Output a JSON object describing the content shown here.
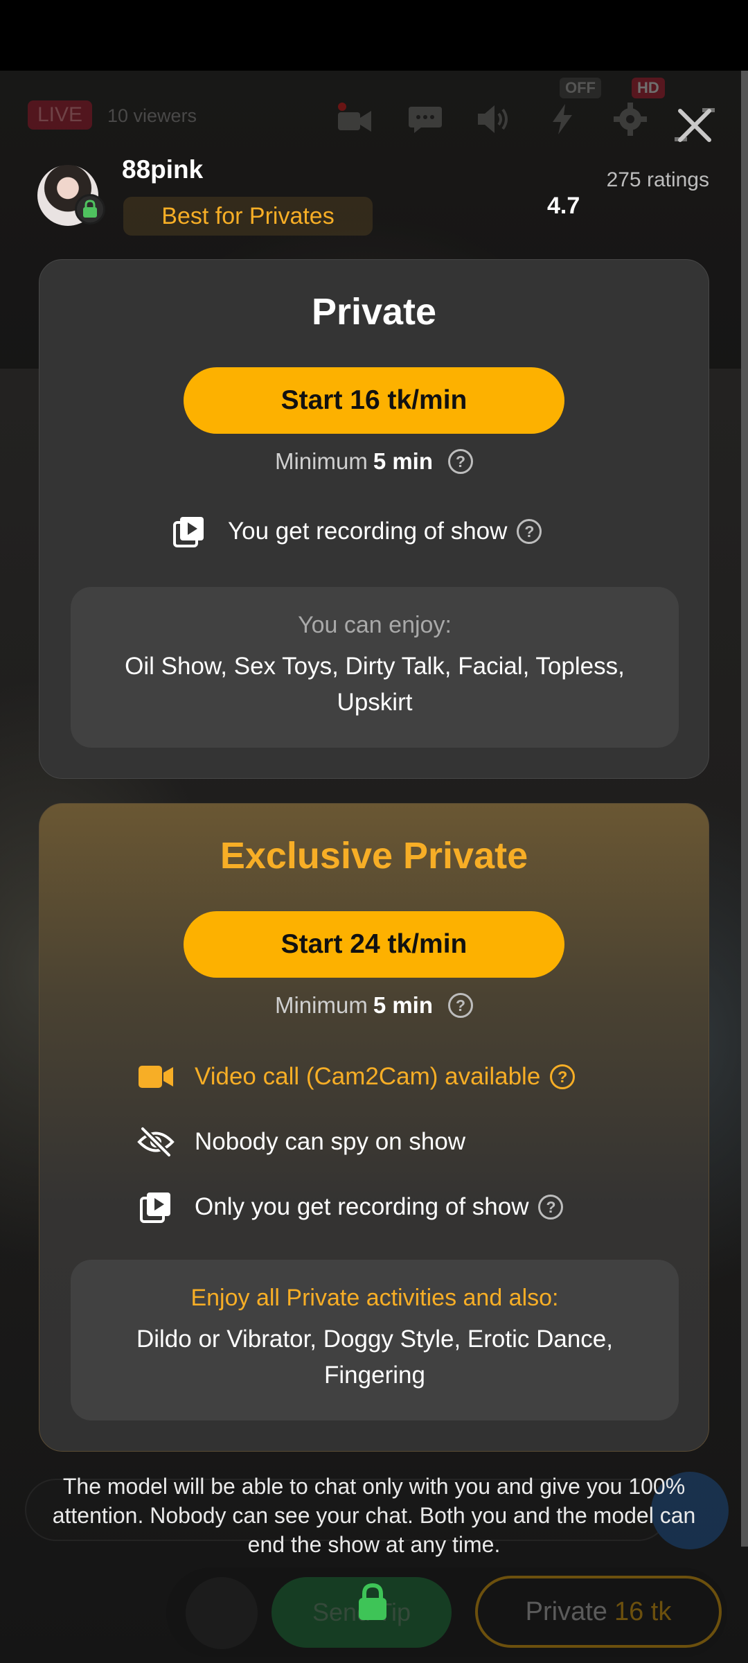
{
  "stream": {
    "live_label": "LIVE",
    "viewers_text": "10 viewers",
    "off_flag": "OFF",
    "hd_flag": "HD",
    "icons": [
      "camera-icon",
      "chat-icon",
      "volume-icon",
      "lightning-icon",
      "gear-icon",
      "close-icon"
    ]
  },
  "model": {
    "name": "88pink",
    "badge": "Best for Privates",
    "ratings_count": "275 ratings",
    "rating": "4.7"
  },
  "private": {
    "title": "Private",
    "start_label": "Start 16 tk/min",
    "minimum_prefix": "Minimum",
    "minimum_value": "5 min",
    "help_glyph": "?",
    "recording_text": "You get recording of show",
    "enjoy_title": "You can enjoy:",
    "enjoy_items": "Oil Show, Sex Toys, Dirty Talk, Facial, Topless, Upskirt"
  },
  "exclusive": {
    "title": "Exclusive Private",
    "start_label": "Start 24 tk/min",
    "minimum_prefix": "Minimum",
    "minimum_value": "5 min",
    "cam2cam_text": "Video call (Cam2Cam) available",
    "nospy_text": "Nobody can spy on show",
    "recording_text": "Only you get recording of show",
    "enjoy_title": "Enjoy all Private activities and also:",
    "enjoy_items": "Dildo or Vibrator, Doggy Style, Erotic Dance, Fingering"
  },
  "description": "The model will be able to chat only with you and give you 100% attention. Nobody can see your chat. Both you and the model can end the show at any time.",
  "bottom_bar": {
    "tip_label": "Send Tip",
    "private_label": "Private",
    "private_price": "16 tk"
  },
  "colors": {
    "accent": "#fdb100",
    "gold_text": "#f7ae26",
    "live_red": "#b3132c",
    "tip_green": "#18803b"
  }
}
